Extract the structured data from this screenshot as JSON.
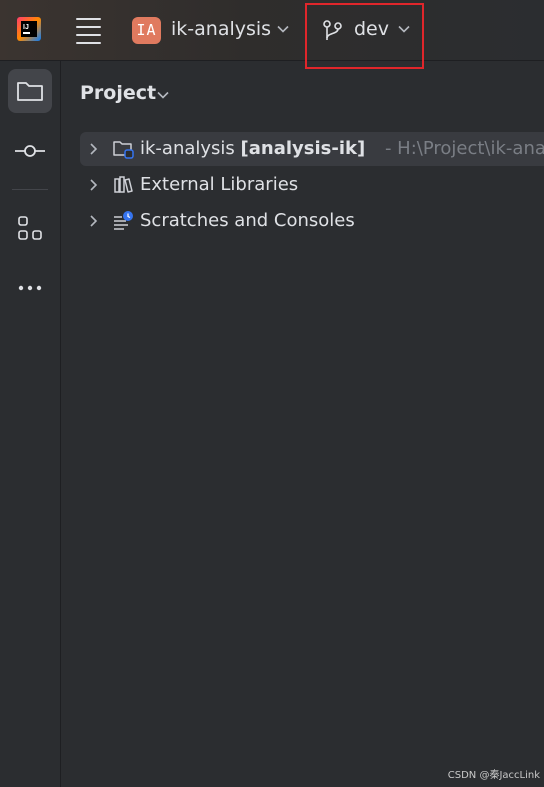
{
  "titlebar": {
    "project_badge": "IA",
    "project_name": "ik-analysis",
    "branch_name": "dev"
  },
  "panel": {
    "title": "Project"
  },
  "tree": {
    "items": [
      {
        "label": "ik-analysis",
        "module": "[analysis-ik]",
        "path": "- H:\\Project\\ik-ana"
      },
      {
        "label": "External Libraries"
      },
      {
        "label": "Scratches and Consoles"
      }
    ]
  },
  "watermark": "CSDN @秦JaccLink",
  "colors": {
    "background": "#2b2d30",
    "selection": "#393b40",
    "badge": "#e07a5f",
    "highlight_box": "#e0262b",
    "accent_blue": "#3574f0"
  }
}
